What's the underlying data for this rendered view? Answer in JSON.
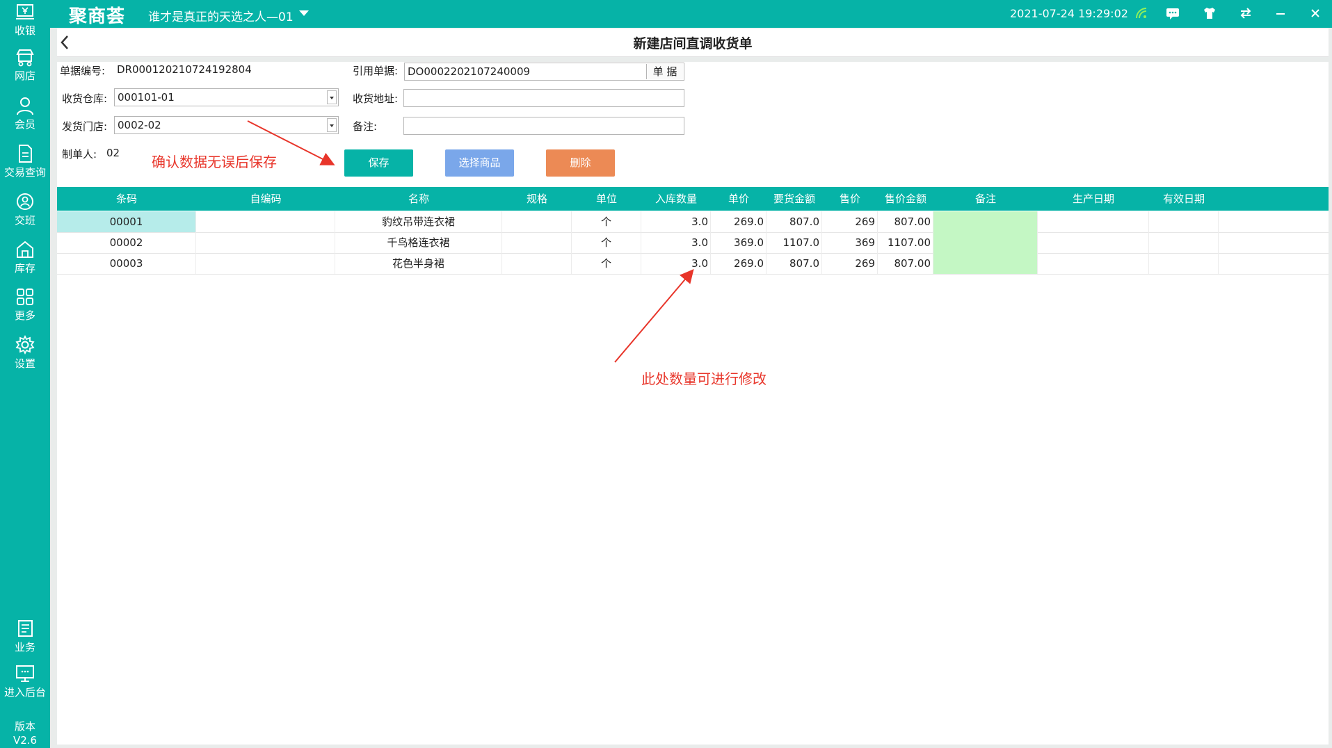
{
  "app": {
    "logo": "聚商荟",
    "store_name": "谁才是真正的天选之人—01",
    "datetime": "2021-07-24 19:29:02",
    "version_label": "版本",
    "version": "V2.6"
  },
  "sidebar": {
    "items": [
      {
        "label": "收银",
        "icon": "cashier-icon"
      },
      {
        "label": "网店",
        "icon": "online-store-icon"
      },
      {
        "label": "会员",
        "icon": "member-icon"
      },
      {
        "label": "交易查询",
        "icon": "transaction-icon"
      },
      {
        "label": "交班",
        "icon": "shift-icon"
      },
      {
        "label": "库存",
        "icon": "inventory-icon"
      },
      {
        "label": "更多",
        "icon": "more-icon"
      },
      {
        "label": "设置",
        "icon": "settings-icon"
      }
    ],
    "bottom_items": [
      {
        "label": "业务",
        "icon": "business-icon"
      },
      {
        "label": "进入后台",
        "icon": "backend-icon"
      }
    ]
  },
  "page": {
    "title": "新建店间直调收货单"
  },
  "form": {
    "doc_no_label": "单据编号:",
    "doc_no": "DR000120210724192804",
    "ref_doc_label": "引用单据:",
    "ref_doc": "DO0002202107240009",
    "ref_doc_button": "单 据",
    "warehouse_label": "收货仓库:",
    "warehouse": "000101-01",
    "address_label": "收货地址:",
    "address": "",
    "store_label": "发货门店:",
    "store": "0002-02",
    "remark_label": "备注:",
    "remark": "",
    "creator_label": "制单人:",
    "creator": "02"
  },
  "buttons": {
    "save": "保存",
    "select_goods": "选择商品",
    "delete": "删除"
  },
  "colors": {
    "primary": "#06b3a7",
    "select_goods": "#7aa7ea",
    "delete": "#ec8a55",
    "annotation": "#e8352a",
    "remark_cell": "#c4f7c4"
  },
  "annotations": {
    "save_hint": "确认数据无误后保存",
    "qty_hint": "此处数量可进行修改"
  },
  "table": {
    "columns": [
      "条码",
      "自编码",
      "名称",
      "规格",
      "单位",
      "入库数量",
      "单价",
      "要货金额",
      "售价",
      "售价金额",
      "备注",
      "生产日期",
      "有效日期"
    ],
    "rows": [
      [
        "00001",
        "",
        "豹纹吊带连衣裙",
        "",
        "个",
        "3.0",
        "269.0",
        "807.0",
        "269",
        "807.00",
        "",
        "",
        ""
      ],
      [
        "00002",
        "",
        "千鸟格连衣裙",
        "",
        "个",
        "3.0",
        "369.0",
        "1107.0",
        "369",
        "1107.00",
        "",
        "",
        ""
      ],
      [
        "00003",
        "",
        "花色半身裙",
        "",
        "个",
        "3.0",
        "269.0",
        "807.0",
        "269",
        "807.00",
        "",
        "",
        ""
      ]
    ]
  }
}
